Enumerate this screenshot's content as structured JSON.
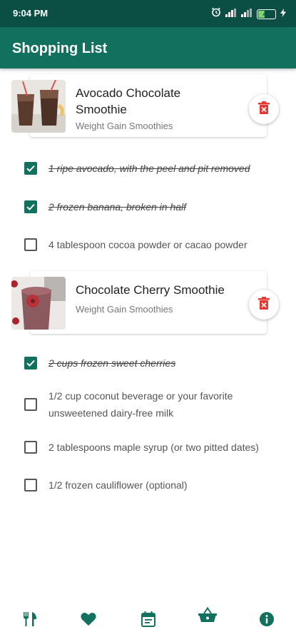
{
  "status": {
    "time": "9:04 PM",
    "battery": "42",
    "battery_level": 0.42
  },
  "app_bar": {
    "title": "Shopping List"
  },
  "recipes": [
    {
      "title": "Avocado Chocolate Smoothie",
      "category": "Weight Gain Smoothies",
      "ingredients": [
        {
          "text": "1 ripe avocado, with the peel and pit removed",
          "checked": true
        },
        {
          "text": "2 frozen banana, broken in half",
          "checked": true
        },
        {
          "text": "4 tablespoon cocoa powder or cacao powder",
          "checked": false
        }
      ]
    },
    {
      "title": "Chocolate Cherry Smoothie",
      "category": "Weight Gain Smoothies",
      "ingredients": [
        {
          "text": "2 cups frozen sweet cherries",
          "checked": true
        },
        {
          "text": "1/2 cup coconut beverage or your favorite unsweetened dairy-free milk",
          "checked": false
        },
        {
          "text": "2 tablespoons maple syrup (or two pitted dates)",
          "checked": false
        },
        {
          "text": "1/2 frozen cauliflower (optional)",
          "checked": false
        }
      ]
    }
  ],
  "bottom_nav": {
    "items": [
      {
        "icon": "fork-knife-icon",
        "active": false
      },
      {
        "icon": "heart-icon",
        "active": false
      },
      {
        "icon": "calendar-icon",
        "active": false
      },
      {
        "icon": "basket-icon",
        "active": true
      },
      {
        "icon": "info-icon",
        "active": false
      }
    ]
  },
  "colors": {
    "primary": "#12705f",
    "status_bar": "#0b4f44",
    "delete": "#e53935"
  }
}
